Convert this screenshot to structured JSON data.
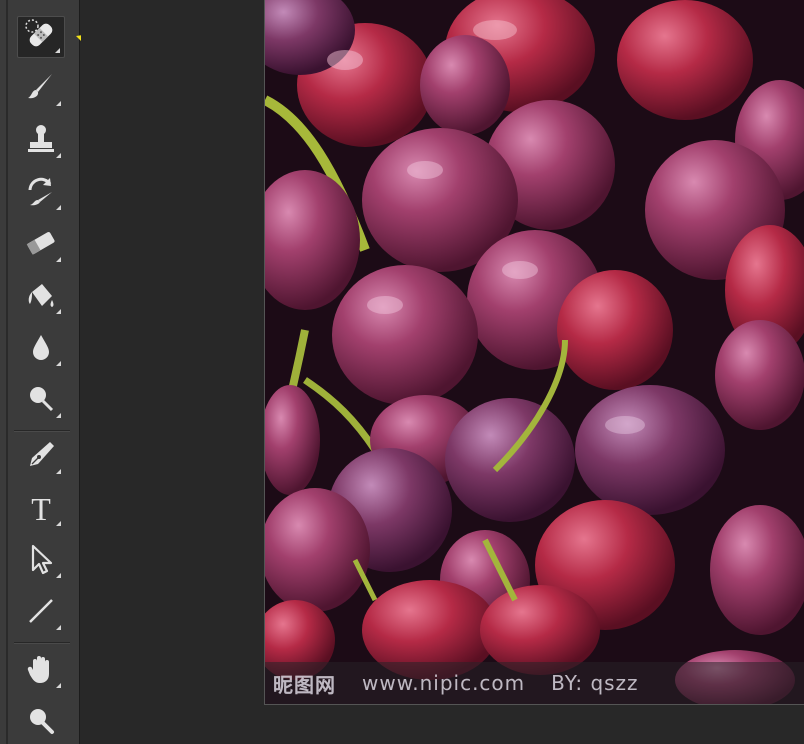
{
  "toolbar": {
    "tools": [
      {
        "name": "spot-healing-brush-icon",
        "active": true
      },
      {
        "name": "brush-icon"
      },
      {
        "name": "clone-stamp-icon"
      },
      {
        "name": "history-brush-icon"
      },
      {
        "name": "eraser-icon"
      },
      {
        "name": "paint-bucket-icon"
      },
      {
        "name": "blur-icon"
      },
      {
        "name": "dodge-icon"
      },
      {
        "name": "pen-icon"
      },
      {
        "name": "type-icon",
        "label": "T"
      },
      {
        "name": "path-selection-icon"
      },
      {
        "name": "line-icon"
      },
      {
        "name": "hand-icon"
      },
      {
        "name": "zoom-icon"
      }
    ]
  },
  "annotation": {
    "arrow_color": "#f2e21a",
    "points_to": "spot-healing-brush-icon"
  },
  "canvas": {
    "watermark": {
      "brand": "昵图网",
      "url": "www.nipic.com",
      "author": "BY: qszz"
    }
  },
  "colors": {
    "toolbar_bg": "#3b3b3b",
    "workspace_bg": "#282828",
    "icon": "#e2e2e2",
    "grape": "#8a2a55"
  }
}
